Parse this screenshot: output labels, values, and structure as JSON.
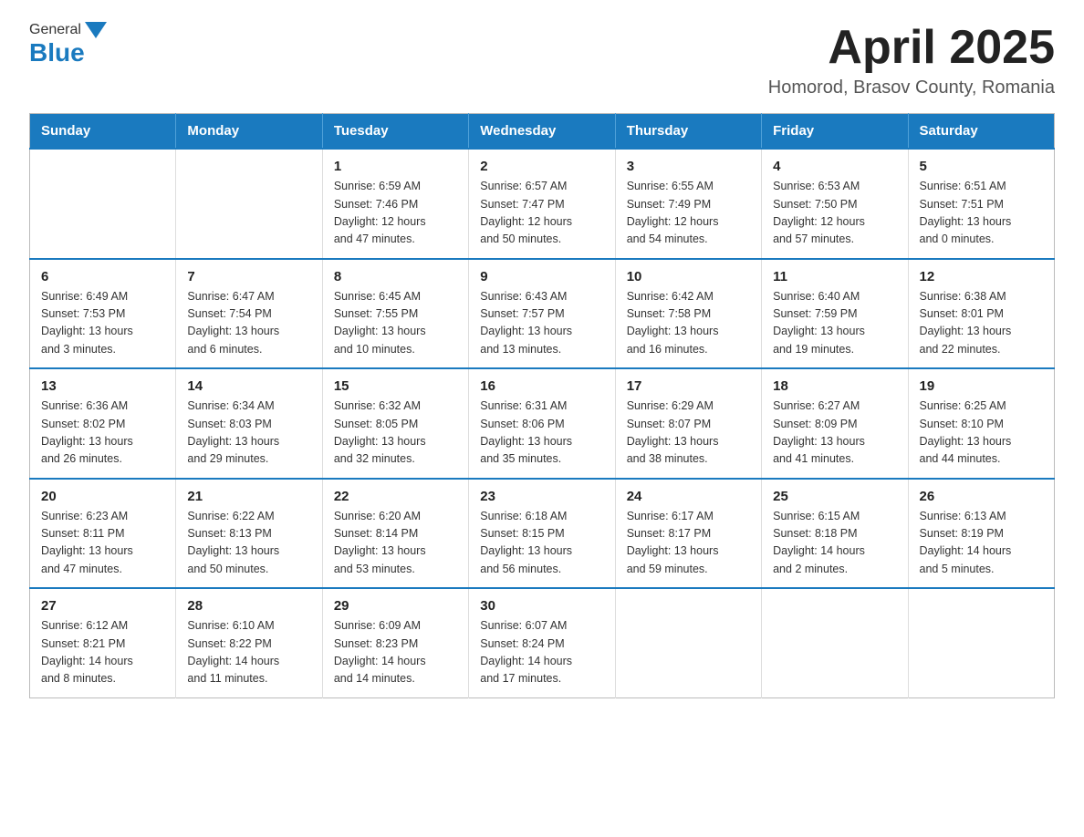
{
  "header": {
    "logo_general": "General",
    "logo_blue": "Blue",
    "month_title": "April 2025",
    "location": "Homorod, Brasov County, Romania"
  },
  "weekdays": [
    "Sunday",
    "Monday",
    "Tuesday",
    "Wednesday",
    "Thursday",
    "Friday",
    "Saturday"
  ],
  "weeks": [
    [
      {
        "day": "",
        "info": ""
      },
      {
        "day": "",
        "info": ""
      },
      {
        "day": "1",
        "info": "Sunrise: 6:59 AM\nSunset: 7:46 PM\nDaylight: 12 hours\nand 47 minutes."
      },
      {
        "day": "2",
        "info": "Sunrise: 6:57 AM\nSunset: 7:47 PM\nDaylight: 12 hours\nand 50 minutes."
      },
      {
        "day": "3",
        "info": "Sunrise: 6:55 AM\nSunset: 7:49 PM\nDaylight: 12 hours\nand 54 minutes."
      },
      {
        "day": "4",
        "info": "Sunrise: 6:53 AM\nSunset: 7:50 PM\nDaylight: 12 hours\nand 57 minutes."
      },
      {
        "day": "5",
        "info": "Sunrise: 6:51 AM\nSunset: 7:51 PM\nDaylight: 13 hours\nand 0 minutes."
      }
    ],
    [
      {
        "day": "6",
        "info": "Sunrise: 6:49 AM\nSunset: 7:53 PM\nDaylight: 13 hours\nand 3 minutes."
      },
      {
        "day": "7",
        "info": "Sunrise: 6:47 AM\nSunset: 7:54 PM\nDaylight: 13 hours\nand 6 minutes."
      },
      {
        "day": "8",
        "info": "Sunrise: 6:45 AM\nSunset: 7:55 PM\nDaylight: 13 hours\nand 10 minutes."
      },
      {
        "day": "9",
        "info": "Sunrise: 6:43 AM\nSunset: 7:57 PM\nDaylight: 13 hours\nand 13 minutes."
      },
      {
        "day": "10",
        "info": "Sunrise: 6:42 AM\nSunset: 7:58 PM\nDaylight: 13 hours\nand 16 minutes."
      },
      {
        "day": "11",
        "info": "Sunrise: 6:40 AM\nSunset: 7:59 PM\nDaylight: 13 hours\nand 19 minutes."
      },
      {
        "day": "12",
        "info": "Sunrise: 6:38 AM\nSunset: 8:01 PM\nDaylight: 13 hours\nand 22 minutes."
      }
    ],
    [
      {
        "day": "13",
        "info": "Sunrise: 6:36 AM\nSunset: 8:02 PM\nDaylight: 13 hours\nand 26 minutes."
      },
      {
        "day": "14",
        "info": "Sunrise: 6:34 AM\nSunset: 8:03 PM\nDaylight: 13 hours\nand 29 minutes."
      },
      {
        "day": "15",
        "info": "Sunrise: 6:32 AM\nSunset: 8:05 PM\nDaylight: 13 hours\nand 32 minutes."
      },
      {
        "day": "16",
        "info": "Sunrise: 6:31 AM\nSunset: 8:06 PM\nDaylight: 13 hours\nand 35 minutes."
      },
      {
        "day": "17",
        "info": "Sunrise: 6:29 AM\nSunset: 8:07 PM\nDaylight: 13 hours\nand 38 minutes."
      },
      {
        "day": "18",
        "info": "Sunrise: 6:27 AM\nSunset: 8:09 PM\nDaylight: 13 hours\nand 41 minutes."
      },
      {
        "day": "19",
        "info": "Sunrise: 6:25 AM\nSunset: 8:10 PM\nDaylight: 13 hours\nand 44 minutes."
      }
    ],
    [
      {
        "day": "20",
        "info": "Sunrise: 6:23 AM\nSunset: 8:11 PM\nDaylight: 13 hours\nand 47 minutes."
      },
      {
        "day": "21",
        "info": "Sunrise: 6:22 AM\nSunset: 8:13 PM\nDaylight: 13 hours\nand 50 minutes."
      },
      {
        "day": "22",
        "info": "Sunrise: 6:20 AM\nSunset: 8:14 PM\nDaylight: 13 hours\nand 53 minutes."
      },
      {
        "day": "23",
        "info": "Sunrise: 6:18 AM\nSunset: 8:15 PM\nDaylight: 13 hours\nand 56 minutes."
      },
      {
        "day": "24",
        "info": "Sunrise: 6:17 AM\nSunset: 8:17 PM\nDaylight: 13 hours\nand 59 minutes."
      },
      {
        "day": "25",
        "info": "Sunrise: 6:15 AM\nSunset: 8:18 PM\nDaylight: 14 hours\nand 2 minutes."
      },
      {
        "day": "26",
        "info": "Sunrise: 6:13 AM\nSunset: 8:19 PM\nDaylight: 14 hours\nand 5 minutes."
      }
    ],
    [
      {
        "day": "27",
        "info": "Sunrise: 6:12 AM\nSunset: 8:21 PM\nDaylight: 14 hours\nand 8 minutes."
      },
      {
        "day": "28",
        "info": "Sunrise: 6:10 AM\nSunset: 8:22 PM\nDaylight: 14 hours\nand 11 minutes."
      },
      {
        "day": "29",
        "info": "Sunrise: 6:09 AM\nSunset: 8:23 PM\nDaylight: 14 hours\nand 14 minutes."
      },
      {
        "day": "30",
        "info": "Sunrise: 6:07 AM\nSunset: 8:24 PM\nDaylight: 14 hours\nand 17 minutes."
      },
      {
        "day": "",
        "info": ""
      },
      {
        "day": "",
        "info": ""
      },
      {
        "day": "",
        "info": ""
      }
    ]
  ]
}
